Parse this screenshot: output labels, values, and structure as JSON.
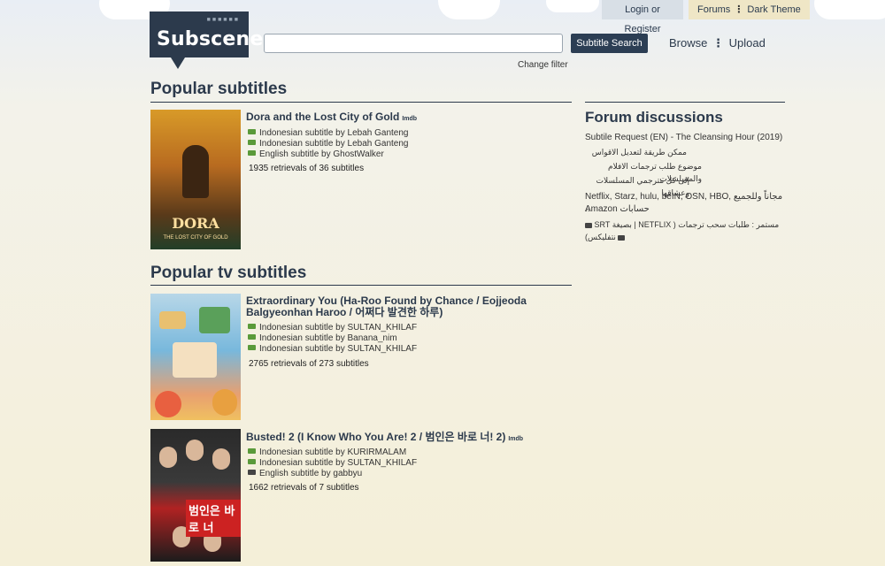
{
  "header": {
    "login_label": "Login or Register",
    "forums_label": "Forums",
    "dark_theme_label": "Dark Theme",
    "logo_text": "Subscene",
    "search_placeholder": "",
    "search_button": "Subtitle Search",
    "change_filter": "Change filter",
    "browse": "Browse",
    "upload": "Upload"
  },
  "popular_subtitles": {
    "title": "Popular subtitles",
    "items": [
      {
        "title": "Dora and the Lost City of Gold",
        "imdb": "Imdb",
        "poster_title": "DORA",
        "poster_subtitle": "THE LOST CITY OF GOLD",
        "subs": [
          "Indonesian subtitle by Lebah Ganteng",
          "Indonesian subtitle by Lebah Ganteng",
          "English subtitle by GhostWalker"
        ],
        "retrievals": "1935 retrievals of 36 subtitles"
      }
    ]
  },
  "popular_tv": {
    "title": "Popular tv subtitles",
    "items": [
      {
        "title_line1": "Extraordinary You (Ha-Roo Found by Chance / Eojjeoda",
        "title_line2": "Balgyeonhan Haroo / 어쩌다 발견한 하루)",
        "subs": [
          "Indonesian subtitle by SULTAN_KHILAF",
          "Indonesian subtitle by Banana_nim",
          "Indonesian subtitle by SULTAN_KHILAF"
        ],
        "retrievals": "2765 retrievals of 273 subtitles"
      },
      {
        "title": "Busted! 2 (I Know Who You Are! 2 / 범인은 바로 너! 2)",
        "imdb": "Imdb",
        "poster_banner": "범인은 바로 너",
        "subs": [
          "Indonesian subtitle by KURIRMALAM",
          "Indonesian subtitle by SULTAN_KHILAF",
          "English subtitle by gabbyu"
        ],
        "retrievals": "1662 retrievals of 7 subtitles"
      }
    ]
  },
  "forum": {
    "title": "Forum discussions",
    "lines": [
      "Subtile Request (EN) - The Cleansing Hour (2019)",
      "ممكن طريقة لتعديل الاقواس",
      "موضوع طلب ترجمات الافلام والمسلسلات",
      "إلى كل مترجمي المسلسلات وعشاقها",
      "Netflix, Starz, hulu, beIN, OSN, HBO, مجاناً وللجميع ..",
      "Amazon حسابات",
      "SRT بصيغة | NETFLIX ) مستمر : طلبات سحب ترجمات",
      "(نتفليكس"
    ]
  }
}
